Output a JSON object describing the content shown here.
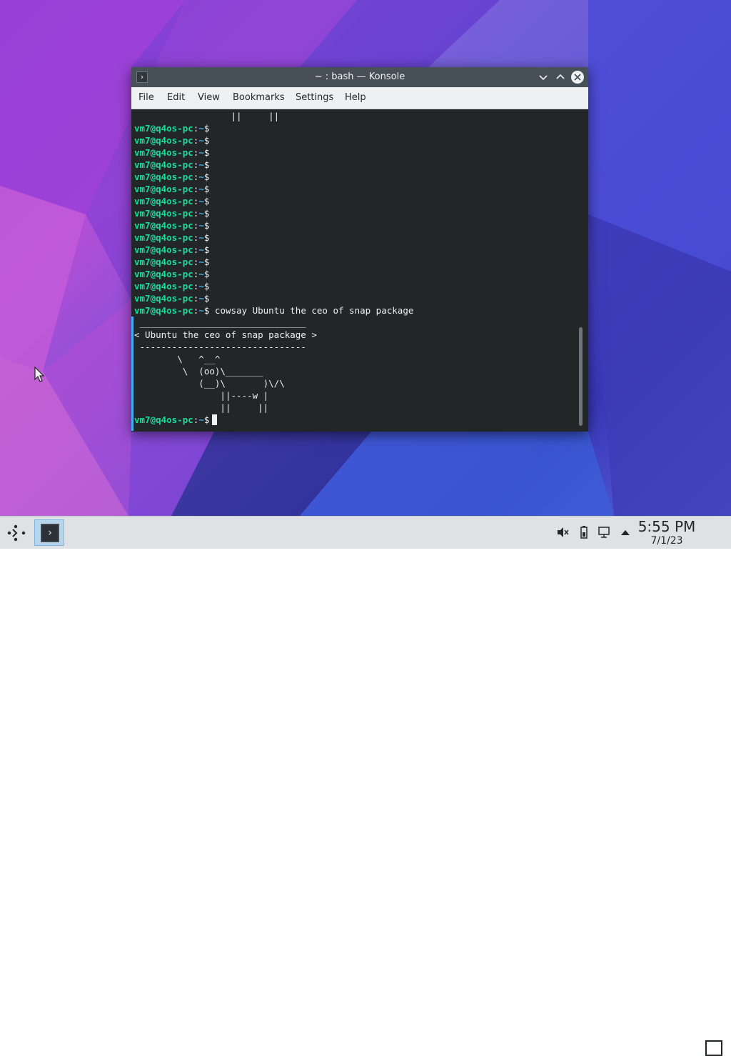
{
  "window": {
    "title": "~ : bash — Konsole",
    "app_icon": "terminal-icon"
  },
  "menubar": [
    "File",
    "Edit",
    "View",
    "Bookmarks",
    "Settings",
    "Help"
  ],
  "terminal": {
    "prompt_user": "vm7@q4os-pc",
    "prompt_path": "~",
    "top_partial_line": "                  ||     ||",
    "empty_prompt_count": 15,
    "command": "cowsay Ubuntu the ceo of snap package",
    "output": [
      " _______________________________",
      "< Ubuntu the ceo of snap package >",
      " -------------------------------",
      "        \\   ^__^",
      "         \\  (oo)\\_______",
      "            (__)\\       )\\/\\",
      "                ||----w |",
      "                ||     ||"
    ]
  },
  "taskbar": {
    "launcher_icon": "application-launcher-icon",
    "task_icon": "konsole-icon",
    "tray": [
      "volume-muted-icon",
      "battery-icon",
      "network-icon",
      "tray-expand-icon"
    ],
    "time": "5:55 PM",
    "date": "7/1/23",
    "show_desktop_icon": "show-desktop-icon"
  },
  "colors": {
    "prompt_user": "#1cdc9a",
    "prompt_path": "#3daee9",
    "terminal_bg": "#232627",
    "titlebar_bg": "#475057",
    "accent": "#3daee9"
  }
}
